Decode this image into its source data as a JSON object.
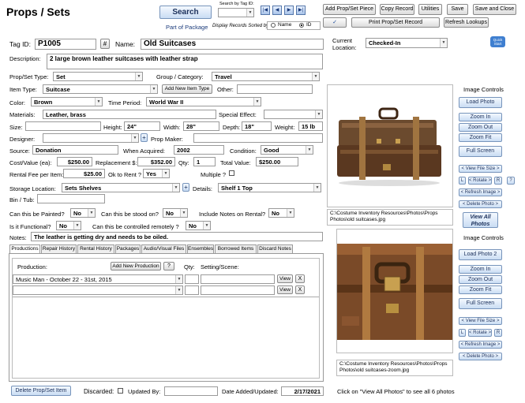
{
  "header": {
    "title": "Props / Sets",
    "search_btn": "Search",
    "search_by_tag_label": "Search by Tag ID:",
    "part_of_package": "Part of Package",
    "sorted_by_label": "Display Records Sorted by:",
    "sort_name": "Name",
    "sort_id": "ID",
    "nav": [
      "|◀",
      "◀",
      "▶",
      "▶|"
    ]
  },
  "toolbar": {
    "add_piece": "Add Prop/Set Piece",
    "copy": "Copy Record",
    "utilities": "Utilities",
    "save": "Save",
    "save_close": "Save and Close",
    "print": "Print Prop/Set Record",
    "refresh": "Refresh Lookups",
    "check_icon": "✓"
  },
  "quick_start": "Quick Start",
  "form": {
    "tag_id_label": "Tag ID:",
    "tag_id": "P1005",
    "hash_btn": "#",
    "name_label": "Name:",
    "name": "Old Suitcases",
    "current_location_label": "Current Location:",
    "current_location": "Checked-In",
    "description_label": "Description:",
    "description": "2 large brown leather suitcases with leather strap",
    "type_label": "Prop/Set Type:",
    "type": "Set",
    "group_label": "Group / Category:",
    "group": "Travel",
    "item_type_label": "Item Type:",
    "item_type": "Suitcase",
    "add_item_type": "Add New Item Type",
    "other_label": "Other:",
    "other": "",
    "color_label": "Color:",
    "color": "Brown",
    "period_label": "Time Period:",
    "period": "World War II",
    "materials_label": "Materials:",
    "materials": "Leather, brass",
    "special_label": "Special Effect:",
    "special": "",
    "size_label": "Size:",
    "size": "",
    "height_label": "Height:",
    "height": "24\"",
    "width_label": "Width:",
    "width": "28\"",
    "depth_label": "Depth:",
    "depth": "18\"",
    "weight_label": "Weight:",
    "weight": "15 lb",
    "designer_label": "Designer:",
    "designer": "",
    "plus": "+",
    "prop_maker_label": "Prop Maker:",
    "prop_maker": "",
    "source_label": "Source:",
    "source": "Donation",
    "acquired_label": "When Acquired:",
    "acquired": "2002",
    "condition_label": "Condition:",
    "condition": "Good",
    "cost_label": "Cost/Value (ea):",
    "cost": "$250.00",
    "replacement_label": "Replacement $:",
    "replacement": "$352.00",
    "qty_label": "Qty:",
    "qty": "1",
    "total_label": "Total Value:",
    "total": "$250.00",
    "rental_label": "Rental Fee per Item:",
    "rental": "$25.00",
    "ok_rent_label": "Ok to Rent ?",
    "ok_rent": "Yes",
    "multiple_label": "Multiple ?",
    "storage_label": "Storage Location:",
    "storage": "Sets Shelves",
    "details_label": "Details:",
    "details": "Shelf 1 Top",
    "bin_label": "Bin / Tub:",
    "bin": "",
    "painted_label": "Can this be Painted?",
    "painted": "No",
    "stood_label": "Can this be stood on?",
    "stood": "No",
    "notes_rental_label": "Include Notes on Rental?",
    "notes_rental": "No",
    "functional_label": "Is it Functional?",
    "functional": "No",
    "remote_label": "Can this be controlled remotely ?",
    "remote": "No",
    "notes_label": "Notes:",
    "notes": "The leather is getting dry and needs to be oiled."
  },
  "tabs": [
    "Productions",
    "Repair History",
    "Rental History",
    "Packages",
    "Audio/Visual Files",
    "Ensembles",
    "Borrowed Items",
    "Discard Notes"
  ],
  "productions": {
    "label": "Production:",
    "add_btn": "Add New Production",
    "help": "?",
    "qty_label": "Qty:",
    "setting_label": "Setting/Scene:",
    "rows": [
      {
        "prod": "Music Man  -  October 22 - 31st, 2015",
        "view": "View",
        "del": "X"
      },
      {
        "prod": "",
        "view": "View",
        "del": "X"
      }
    ]
  },
  "photos": {
    "image_controls": "Image Controls",
    "load1": "Load Photo",
    "load2": "Load Photo 2",
    "zoom_in": "Zoom In",
    "zoom_out": "Zoom Out",
    "zoom_fit": "Zoom Fit",
    "full_screen": "Full Screen",
    "view_size": "< View File Size >",
    "l": "L",
    "rotate": "< Rotate >",
    "r": "R",
    "q": "?",
    "refresh_image": "< Refresh Image >",
    "delete_photo": "< Delete Photo >",
    "view_all": "View All Photos",
    "caption1": "C:\\Costume Inventory Resources\\Photos\\Props Photos\\old suitcases.jpg",
    "caption2": "C:\\Costume Inventory Resources\\Photos\\Props Photos\\old suitcases-zoom.jpg",
    "see_all": "Click on \"View All Photos\" to see all 6 photos"
  },
  "footer": {
    "delete_btn": "Delete Prop/Set Item",
    "discarded_label": "Discarded:",
    "updated_by_label": "Updated By:",
    "updated_by": "",
    "date_label": "Date Added/Updated:",
    "date": "2/17/2021"
  }
}
